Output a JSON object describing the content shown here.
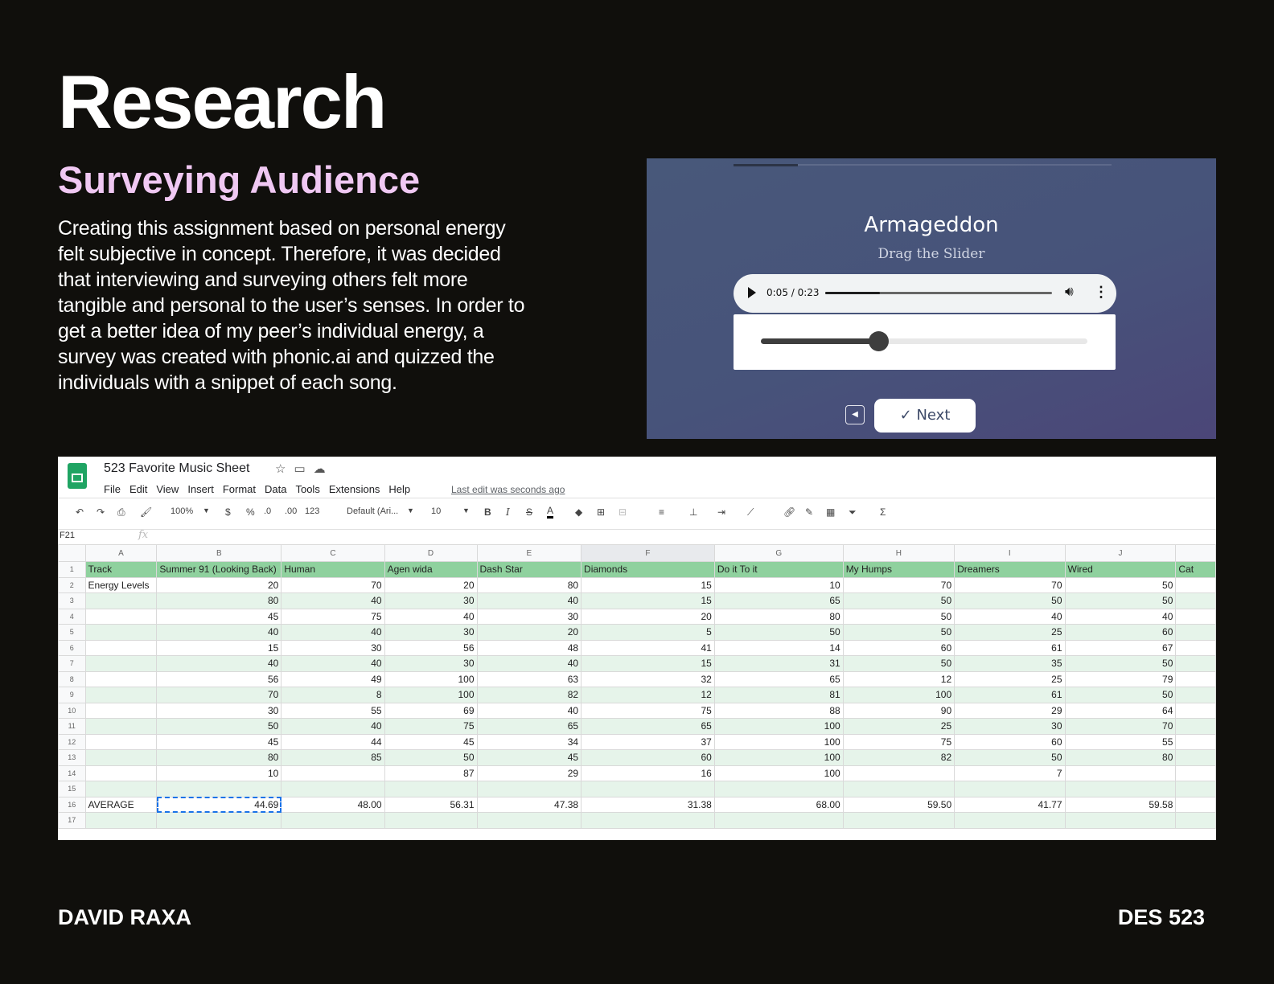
{
  "slide": {
    "title": "Research",
    "subtitle": "Surveying Audience",
    "body": "Creating this assignment based on personal energy felt subjective in concept. Therefore, it was decided that interviewing and surveying others felt more tangible and personal to the user’s senses. In order to get a better idea of my peer’s individual energy, a survey was created with phonic.ai and quizzed the individuals with a snippet of each song.",
    "footer_left": "DAVID RAXA",
    "footer_right": "DES 523"
  },
  "survey": {
    "song_title": "Armageddon",
    "hint": "Drag the Slider",
    "audio_time": "0:05 / 0:23",
    "audio_progress": 0.24,
    "slider_value": 0.36,
    "step_progress": 0.17,
    "next_label": "Next",
    "icons": {
      "play": "play-icon",
      "volume": "volume-icon",
      "more": "more-vert-icon",
      "back": "chevron-left-icon",
      "check": "check-icon"
    }
  },
  "sheet": {
    "doc_title": "523 Favorite Music Sheet",
    "menus": [
      "File",
      "Edit",
      "View",
      "Insert",
      "Format",
      "Data",
      "Tools",
      "Extensions",
      "Help"
    ],
    "last_edit": "Last edit was seconds ago",
    "toolbar": {
      "zoom": "100%",
      "currency": "$",
      "percent": "%",
      "dec_less": ".0",
      "dec_more": ".00",
      "format": "123",
      "font": "Default (Ari...",
      "font_size": "10",
      "bold": "B",
      "italic": "I",
      "strike": "S",
      "text_color": "A"
    },
    "cell_ref": "F21",
    "fx": "fx",
    "column_letters": [
      "A",
      "B",
      "C",
      "D",
      "E",
      "F",
      "G",
      "H",
      "I",
      "J",
      ""
    ],
    "selected_column": "F",
    "headers": [
      "Track",
      "Summer 91 (Looking Back)",
      "Human",
      "Agen wida",
      "Dash Star",
      "Diamonds",
      "Do it To it",
      "My Humps",
      "Dreamers",
      "Wired",
      "Cat"
    ],
    "rows": [
      [
        "Energy Levels",
        "20",
        "70",
        "20",
        "80",
        "15",
        "10",
        "70",
        "70",
        "50",
        ""
      ],
      [
        "",
        "80",
        "40",
        "30",
        "40",
        "15",
        "65",
        "50",
        "50",
        "50",
        ""
      ],
      [
        "",
        "45",
        "75",
        "40",
        "30",
        "20",
        "80",
        "50",
        "40",
        "40",
        ""
      ],
      [
        "",
        "40",
        "40",
        "30",
        "20",
        "5",
        "50",
        "50",
        "25",
        "60",
        ""
      ],
      [
        "",
        "15",
        "30",
        "56",
        "48",
        "41",
        "14",
        "60",
        "61",
        "67",
        ""
      ],
      [
        "",
        "40",
        "40",
        "30",
        "40",
        "15",
        "31",
        "50",
        "35",
        "50",
        ""
      ],
      [
        "",
        "56",
        "49",
        "100",
        "63",
        "32",
        "65",
        "12",
        "25",
        "79",
        ""
      ],
      [
        "",
        "70",
        "8",
        "100",
        "82",
        "12",
        "81",
        "100",
        "61",
        "50",
        ""
      ],
      [
        "",
        "30",
        "55",
        "69",
        "40",
        "75",
        "88",
        "90",
        "29",
        "64",
        ""
      ],
      [
        "",
        "50",
        "40",
        "75",
        "65",
        "65",
        "100",
        "25",
        "30",
        "70",
        ""
      ],
      [
        "",
        "45",
        "44",
        "45",
        "34",
        "37",
        "100",
        "75",
        "60",
        "55",
        ""
      ],
      [
        "",
        "80",
        "85",
        "50",
        "45",
        "60",
        "100",
        "82",
        "50",
        "80",
        ""
      ],
      [
        "",
        "10",
        "",
        "87",
        "29",
        "16",
        "100",
        "",
        "7",
        "",
        ""
      ],
      [
        "",
        "",
        "",
        "",
        "",
        "",
        "",
        "",
        "",
        "",
        ""
      ],
      [
        "AVERAGE",
        "44.69",
        "48.00",
        "56.31",
        "47.38",
        "31.38",
        "68.00",
        "59.50",
        "41.77",
        "59.58",
        ""
      ],
      [
        "",
        "",
        "",
        "",
        "",
        "",
        "",
        "",
        "",
        "",
        ""
      ]
    ]
  },
  "colors": {
    "background": "#100f0c",
    "subtitle": "#f0c8f3",
    "header_green": "#8fd19e",
    "band_green": "#e6f4ea",
    "sheets_green": "#1fa463"
  }
}
